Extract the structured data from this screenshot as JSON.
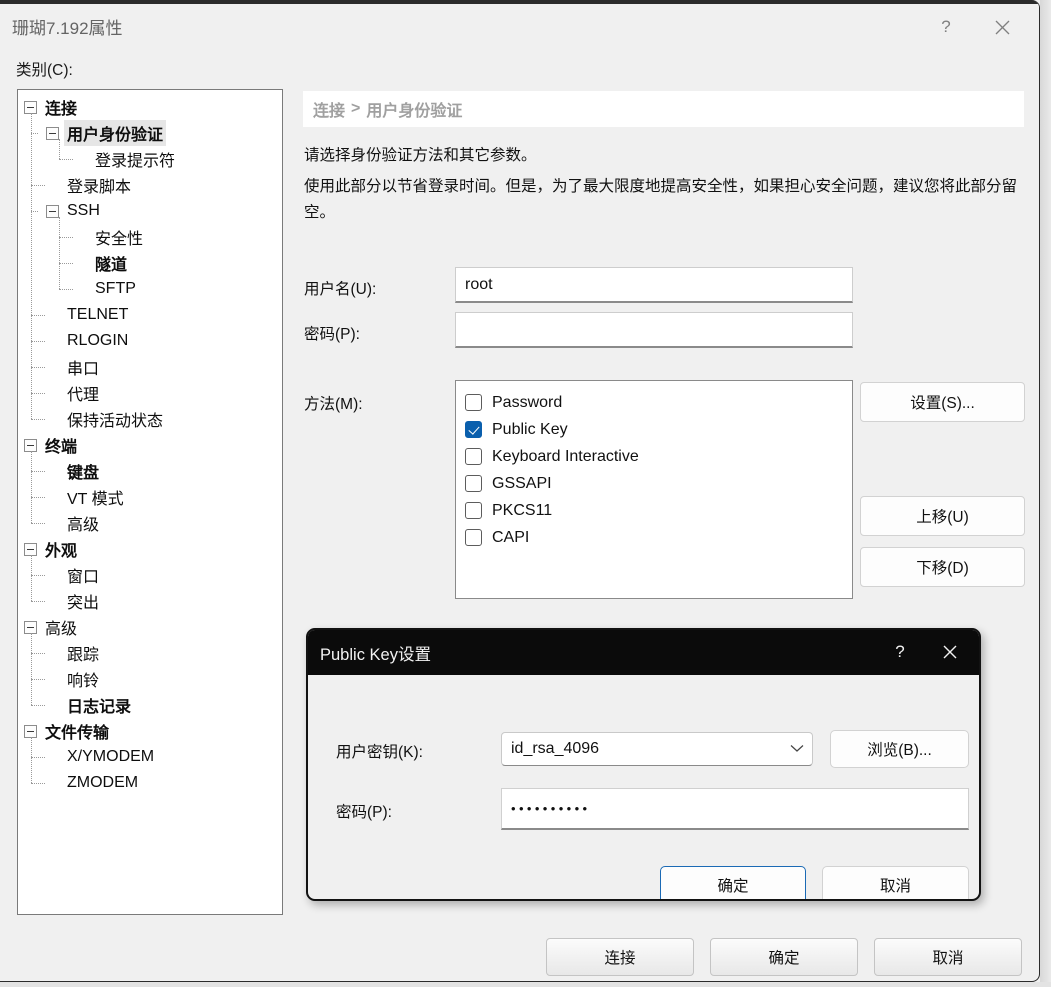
{
  "window": {
    "title": "珊瑚7.192属性",
    "help_icon": "?",
    "close_icon": "close-icon"
  },
  "category": {
    "label": "类别(C):",
    "tree": [
      {
        "label": "连接",
        "level": 0,
        "expander": "minus",
        "bold": true,
        "selected": false
      },
      {
        "label": "用户身份验证",
        "level": 1,
        "expander": "minus",
        "bold": true,
        "selected": true
      },
      {
        "label": "登录提示符",
        "level": 2,
        "expander": "none",
        "bold": false,
        "selected": false
      },
      {
        "label": "登录脚本",
        "level": 1,
        "expander": "none",
        "bold": false,
        "selected": false
      },
      {
        "label": "SSH",
        "level": 1,
        "expander": "minus",
        "bold": false,
        "selected": false
      },
      {
        "label": "安全性",
        "level": 2,
        "expander": "none",
        "bold": false,
        "selected": false
      },
      {
        "label": "隧道",
        "level": 2,
        "expander": "none",
        "bold": true,
        "selected": false
      },
      {
        "label": "SFTP",
        "level": 2,
        "expander": "none",
        "bold": false,
        "selected": false
      },
      {
        "label": "TELNET",
        "level": 1,
        "expander": "none",
        "bold": false,
        "selected": false
      },
      {
        "label": "RLOGIN",
        "level": 1,
        "expander": "none",
        "bold": false,
        "selected": false
      },
      {
        "label": "串口",
        "level": 1,
        "expander": "none",
        "bold": false,
        "selected": false
      },
      {
        "label": "代理",
        "level": 1,
        "expander": "none",
        "bold": false,
        "selected": false
      },
      {
        "label": "保持活动状态",
        "level": 1,
        "expander": "none",
        "bold": false,
        "selected": false
      },
      {
        "label": "终端",
        "level": 0,
        "expander": "minus",
        "bold": true,
        "selected": false
      },
      {
        "label": "键盘",
        "level": 1,
        "expander": "none",
        "bold": true,
        "selected": false
      },
      {
        "label": "VT 模式",
        "level": 1,
        "expander": "none",
        "bold": false,
        "selected": false
      },
      {
        "label": "高级",
        "level": 1,
        "expander": "none",
        "bold": false,
        "selected": false
      },
      {
        "label": "外观",
        "level": 0,
        "expander": "minus",
        "bold": true,
        "selected": false
      },
      {
        "label": "窗口",
        "level": 1,
        "expander": "none",
        "bold": false,
        "selected": false
      },
      {
        "label": "突出",
        "level": 1,
        "expander": "none",
        "bold": false,
        "selected": false
      },
      {
        "label": "高级",
        "level": 0,
        "expander": "minus",
        "bold": false,
        "selected": false
      },
      {
        "label": "跟踪",
        "level": 1,
        "expander": "none",
        "bold": false,
        "selected": false
      },
      {
        "label": "响铃",
        "level": 1,
        "expander": "none",
        "bold": false,
        "selected": false
      },
      {
        "label": "日志记录",
        "level": 1,
        "expander": "none",
        "bold": true,
        "selected": false
      },
      {
        "label": "文件传输",
        "level": 0,
        "expander": "minus",
        "bold": true,
        "selected": false
      },
      {
        "label": "X/YMODEM",
        "level": 1,
        "expander": "none",
        "bold": false,
        "selected": false
      },
      {
        "label": "ZMODEM",
        "level": 1,
        "expander": "none",
        "bold": false,
        "selected": false
      }
    ]
  },
  "panel": {
    "breadcrumb_root": "连接",
    "breadcrumb_sep": ">",
    "breadcrumb_leaf": "用户身份验证",
    "desc_line1": "请选择身份验证方法和其它参数。",
    "desc_line2": "使用此部分以节省登录时间。但是，为了最大限度地提高安全性，如果担心安全问题，建议您将此部分留空。",
    "username_label": "用户名(U):",
    "username_value": "root",
    "password_label": "密码(P):",
    "password_value": "",
    "methods_label": "方法(M):",
    "methods": [
      {
        "label": "Password",
        "checked": false
      },
      {
        "label": "Public Key",
        "checked": true
      },
      {
        "label": "Keyboard Interactive",
        "checked": false
      },
      {
        "label": "GSSAPI",
        "checked": false
      },
      {
        "label": "PKCS11",
        "checked": false
      },
      {
        "label": "CAPI",
        "checked": false
      }
    ],
    "btn_properties": "设置(S)...",
    "btn_moveup": "上移(U)",
    "btn_movedown": "下移(D)"
  },
  "footer": {
    "connect": "连接",
    "ok": "确定",
    "cancel": "取消"
  },
  "modal": {
    "title": "Public Key设置",
    "help_icon": "?",
    "close_icon": "close-icon",
    "userkey_label": "用户密钥(K):",
    "userkey_value": "id_rsa_4096",
    "password_label": "密码(P):",
    "password_value": "••••••••••",
    "browse": "浏览(B)...",
    "ok": "确定",
    "cancel": "取消"
  },
  "colors": {
    "accent": "#0a5fad",
    "focus_border": "#1b6ab5",
    "title_bar": "#0b0b0b",
    "window_bg": "#f0f0f0"
  }
}
